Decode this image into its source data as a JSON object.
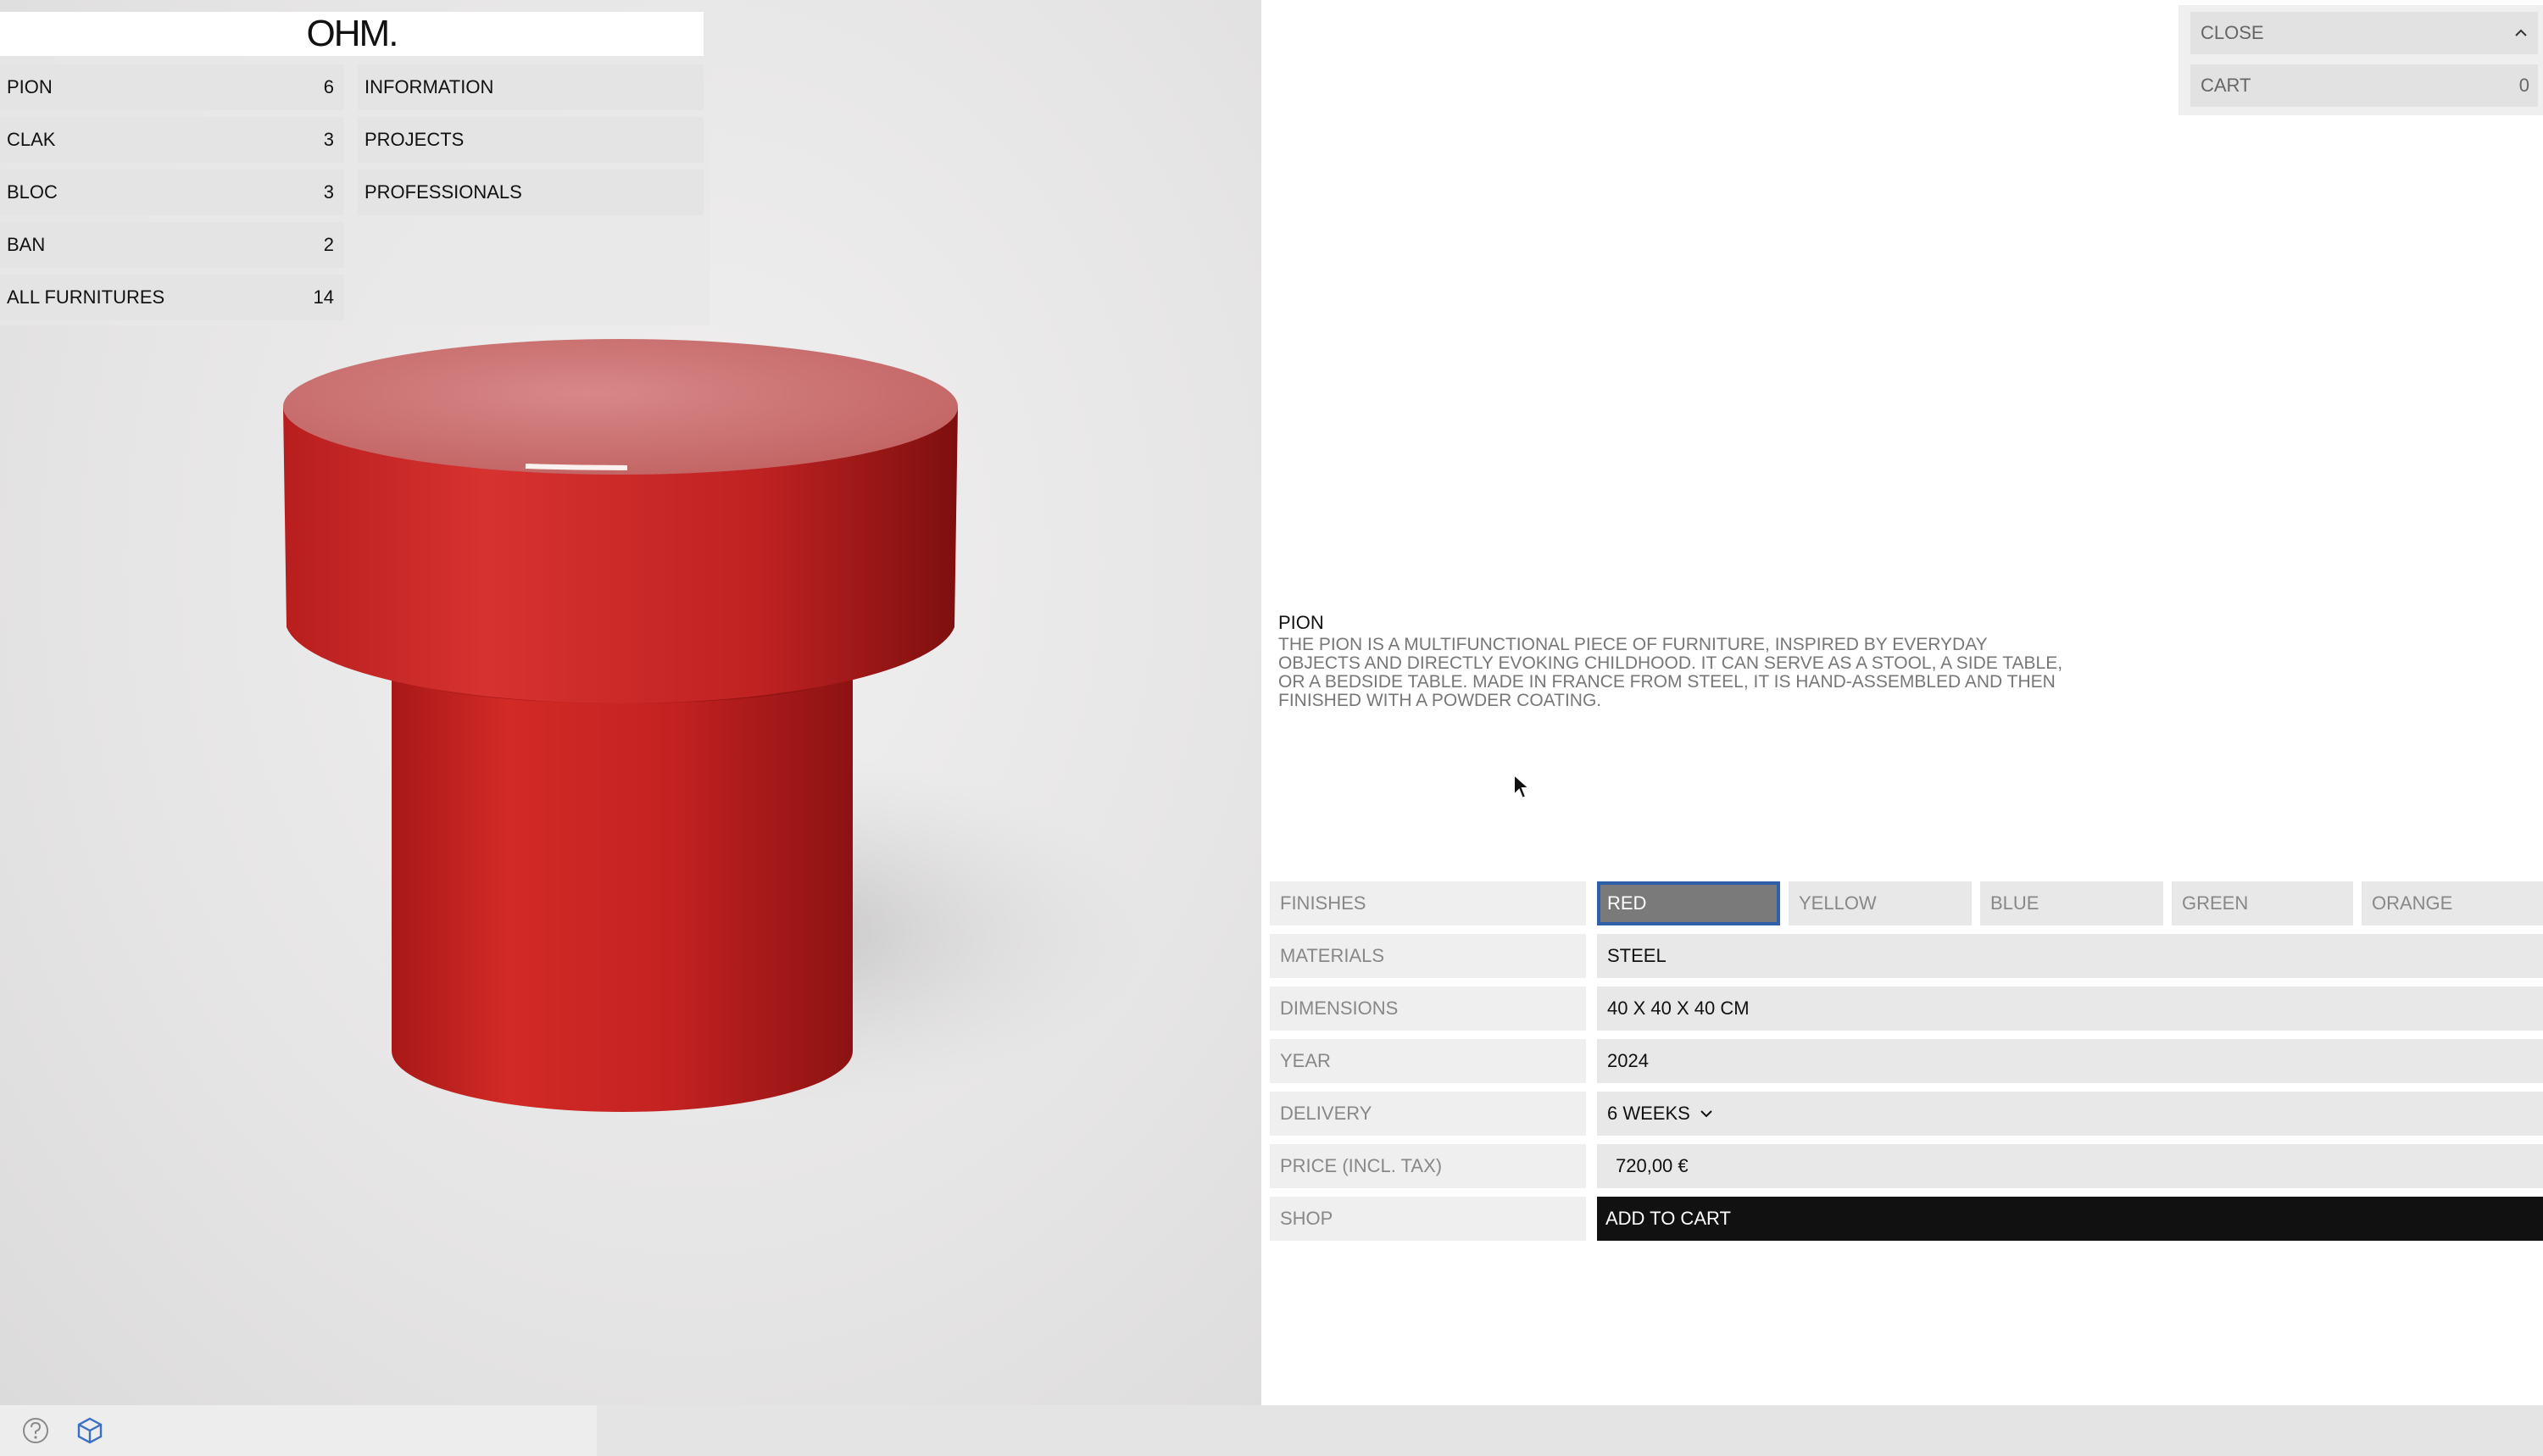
{
  "brand": {
    "logo": "OHM."
  },
  "nav": {
    "products": [
      {
        "label": "PION",
        "count": "6"
      },
      {
        "label": "CLAK",
        "count": "3"
      },
      {
        "label": "BLOC",
        "count": "3"
      },
      {
        "label": "BAN",
        "count": "2"
      },
      {
        "label": "ALL FURNITURES",
        "count": "14"
      }
    ],
    "pages": [
      {
        "label": "INFORMATION"
      },
      {
        "label": "PROJECTS"
      },
      {
        "label": "PROFESSIONALS"
      }
    ]
  },
  "topright": {
    "close_label": "CLOSE",
    "cart_label": "CART",
    "cart_count": "0"
  },
  "product": {
    "name": "PION",
    "description": "THE PION IS A MULTIFUNCTIONAL PIECE OF FURNITURE, INSPIRED BY EVERYDAY OBJECTS AND DIRECTLY EVOKING CHILDHOOD. IT CAN SERVE AS A STOOL, A SIDE TABLE, OR A BEDSIDE TABLE. MADE IN FRANCE FROM STEEL, IT IS HAND-ASSEMBLED AND THEN FINISHED WITH A POWDER COATING.",
    "color": "#c42222"
  },
  "specs": {
    "finishes_label": "FINISHES",
    "finishes": [
      "RED",
      "YELLOW",
      "BLUE",
      "GREEN",
      "ORANGE"
    ],
    "selected_finish": "RED",
    "materials_label": "MATERIALS",
    "materials": "STEEL",
    "dimensions_label": "DIMENSIONS",
    "dimensions": "40 X 40 X 40 CM",
    "year_label": "YEAR",
    "year": "2024",
    "delivery_label": "DELIVERY",
    "delivery": "6 WEEKS",
    "price_label": "PRICE (INCL. TAX)",
    "price": "720,00 €",
    "shop_label": "SHOP",
    "add_to_cart": "ADD TO CART"
  },
  "icons": [
    "help-icon",
    "box-icon",
    "chevron-up-icon",
    "chevron-down-icon",
    "mouse-cursor-icon"
  ]
}
